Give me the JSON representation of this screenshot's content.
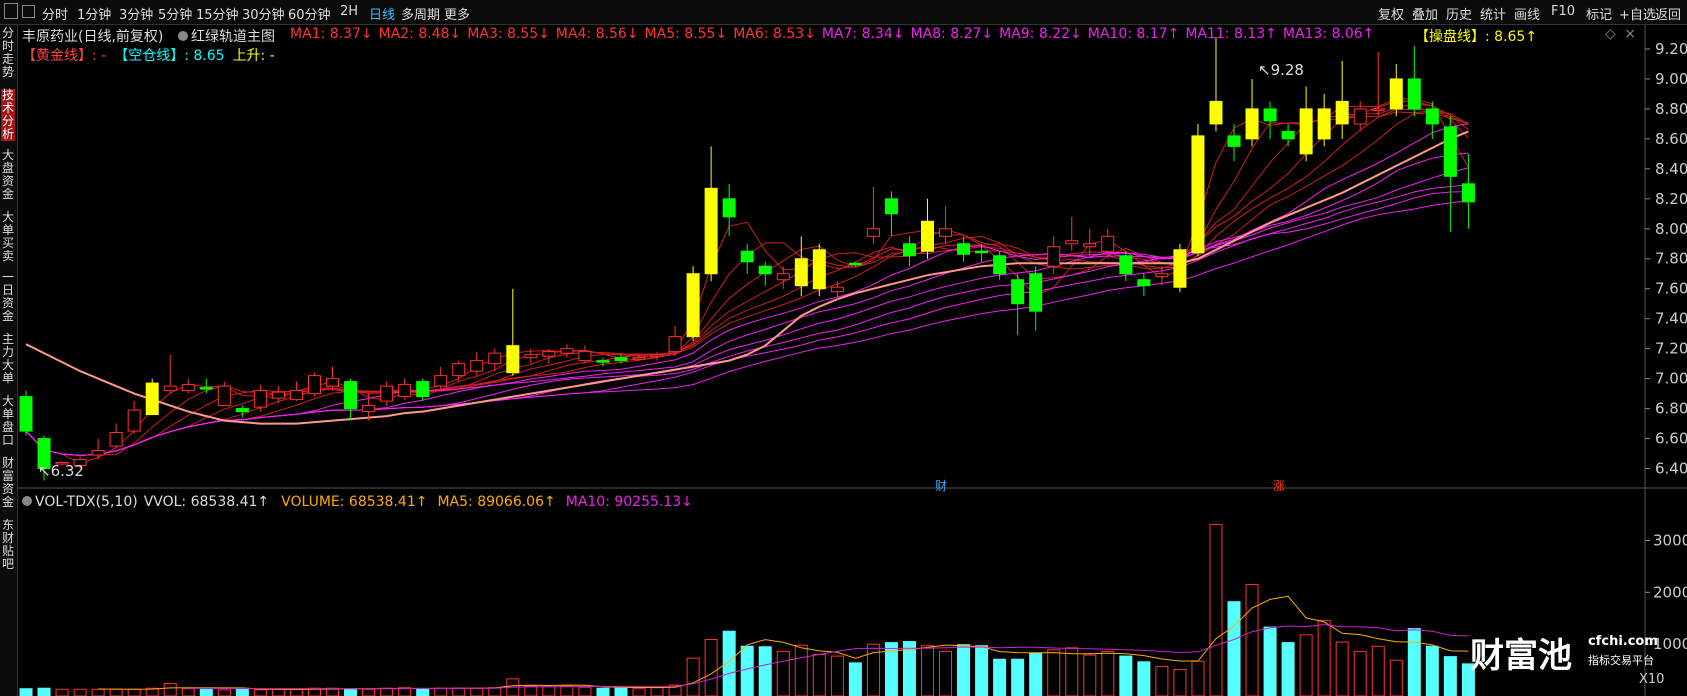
{
  "topbar": {
    "left_icons": [
      "grid-icon",
      "sidebar-icon"
    ],
    "periods": [
      "分时",
      "1分钟",
      "3分钟",
      "5分钟",
      "15分钟",
      "30分钟",
      "60分钟",
      "2H",
      "日线",
      "多周期",
      "更多"
    ],
    "active_period": "日线",
    "right": [
      "复权",
      "叠加",
      "历史",
      "统计",
      "画线",
      "F10",
      "标记",
      "+自选",
      "返回"
    ]
  },
  "leftnav": [
    "分时走势",
    "技术分析",
    "大盘资金",
    "大单买卖",
    "一日资金",
    "主力大单",
    "大单盘口",
    "财富资金",
    "东财贴吧"
  ],
  "leftnav_active": "技术分析",
  "header": {
    "stock": "丰原药业(日线,前复权)",
    "indicator": "红绿轨道主图",
    "ma": [
      {
        "label": "MA1: 8.37↓",
        "color": "#ff3333"
      },
      {
        "label": "MA2: 8.48↓",
        "color": "#ff3333"
      },
      {
        "label": "MA3: 8.55↓",
        "color": "#ff3333"
      },
      {
        "label": "MA4: 8.56↓",
        "color": "#ff3333"
      },
      {
        "label": "MA5: 8.55↓",
        "color": "#ff3333"
      },
      {
        "label": "MA6: 8.53↓",
        "color": "#ff3333"
      },
      {
        "label": "MA7: 8.34↓",
        "color": "#ee22ee"
      },
      {
        "label": "MA8: 8.27↓",
        "color": "#ee22ee"
      },
      {
        "label": "MA9: 8.22↓",
        "color": "#ee22ee"
      },
      {
        "label": "MA10: 8.17↑",
        "color": "#ee22ee"
      },
      {
        "label": "MA11: 8.13↑",
        "color": "#ee22ee"
      },
      {
        "label": "MA13: 8.06↑",
        "color": "#ee22ee"
      }
    ],
    "caopan": "【操盘线】: 8.65↑",
    "huangjin": "【黄金线】: -",
    "kongcang": "【空仓线】: 8.65",
    "shangsheng": "上升: -"
  },
  "volume_header": {
    "name": "VOL-TDX(5,10)",
    "vvol": "VVOL: 68538.41↑",
    "volume": "VOLUME: 68538.41↑",
    "ma5": "MA5: 89066.06↑",
    "ma10": "MA10: 90255.13↓"
  },
  "markers": {
    "cai": "财",
    "zhang": "涨",
    "high": "9.28",
    "low": "6.32"
  },
  "watermark": {
    "logo": "财富池",
    "domain": "cfchi.com",
    "slogan": "指标交易平台"
  },
  "colors": {
    "up": "#ff3232",
    "down": "#00ff00",
    "yellow": "#ffff00",
    "cyan": "#00ffff",
    "magenta": "#ee22ee",
    "salmon": "#ff9a8a",
    "vol_up": "#ff3232",
    "vol_down": "#5ff"
  },
  "chart_data": {
    "type": "candlestick",
    "title": "丰原药业(日线,前复权)",
    "price_axis": {
      "ticks": [
        6.4,
        6.6,
        6.8,
        7.0,
        7.2,
        7.4,
        7.6,
        7.8,
        8.0,
        8.2,
        8.4,
        8.6,
        8.8,
        9.0,
        9.2
      ],
      "range": [
        6.27,
        9.36
      ]
    },
    "volume_axis": {
      "ticks": [
        10000,
        20000,
        30000
      ],
      "range": [
        0,
        35500
      ],
      "unit": "X10"
    },
    "candles": [
      [
        6.88,
        6.65,
        6.92,
        6.62
      ],
      [
        6.6,
        6.4,
        6.62,
        6.32
      ],
      [
        6.43,
        6.44,
        6.45,
        6.42
      ],
      [
        6.42,
        6.46,
        6.48,
        6.4
      ],
      [
        6.49,
        6.52,
        6.6,
        6.46
      ],
      [
        6.55,
        6.64,
        6.7,
        6.54
      ],
      [
        6.65,
        6.79,
        6.85,
        6.63
      ],
      [
        6.76,
        6.97,
        7.0,
        6.76
      ],
      [
        6.92,
        6.95,
        7.16,
        6.9
      ],
      [
        6.92,
        6.96,
        7.0,
        6.9
      ],
      [
        6.94,
        6.93,
        7.0,
        6.9
      ],
      [
        6.82,
        6.95,
        6.98,
        6.82
      ],
      [
        6.8,
        6.78,
        6.82,
        6.74
      ],
      [
        6.81,
        6.92,
        6.96,
        6.78
      ],
      [
        6.87,
        6.91,
        6.95,
        6.84
      ],
      [
        6.86,
        6.92,
        6.98,
        6.85
      ],
      [
        6.9,
        7.02,
        7.04,
        6.88
      ],
      [
        6.95,
        7.0,
        7.08,
        6.92
      ],
      [
        6.98,
        6.8,
        7.0,
        6.72
      ],
      [
        6.78,
        6.82,
        6.9,
        6.72
      ],
      [
        6.85,
        6.95,
        6.98,
        6.82
      ],
      [
        6.88,
        6.96,
        7.0,
        6.86
      ],
      [
        6.98,
        6.88,
        7.0,
        6.85
      ],
      [
        6.95,
        7.02,
        7.08,
        6.92
      ],
      [
        7.02,
        7.1,
        7.12,
        6.98
      ],
      [
        7.05,
        7.12,
        7.18,
        7.02
      ],
      [
        7.1,
        7.17,
        7.2,
        7.05
      ],
      [
        7.04,
        7.22,
        7.6,
        7.02
      ],
      [
        7.14,
        7.16,
        7.2,
        7.1
      ],
      [
        7.15,
        7.18,
        7.2,
        7.1
      ],
      [
        7.17,
        7.2,
        7.23,
        7.14
      ],
      [
        7.12,
        7.18,
        7.22,
        7.1
      ],
      [
        7.12,
        7.11,
        7.14,
        7.08
      ],
      [
        7.14,
        7.12,
        7.16,
        7.1
      ],
      [
        7.14,
        7.14,
        7.16,
        7.12
      ],
      [
        7.15,
        7.16,
        7.18,
        7.12
      ],
      [
        7.18,
        7.28,
        7.35,
        7.15
      ],
      [
        7.28,
        7.7,
        7.75,
        7.25
      ],
      [
        7.7,
        8.27,
        8.55,
        7.65
      ],
      [
        8.2,
        8.08,
        8.3,
        7.95
      ],
      [
        7.85,
        7.78,
        7.9,
        7.7
      ],
      [
        7.75,
        7.7,
        7.78,
        7.62
      ],
      [
        7.66,
        7.7,
        7.75,
        7.6
      ],
      [
        7.62,
        7.8,
        7.95,
        7.55
      ],
      [
        7.6,
        7.86,
        7.9,
        7.55
      ],
      [
        7.58,
        7.61,
        7.65,
        7.52
      ],
      [
        7.77,
        7.76,
        7.78,
        7.75
      ],
      [
        7.95,
        8.0,
        8.28,
        7.9
      ],
      [
        8.2,
        8.1,
        8.25,
        7.95
      ],
      [
        7.9,
        7.82,
        7.95,
        7.75
      ],
      [
        7.85,
        8.05,
        8.2,
        7.8
      ],
      [
        7.95,
        8.0,
        8.15,
        7.9
      ],
      [
        7.9,
        7.83,
        7.95,
        7.78
      ],
      [
        7.85,
        7.84,
        7.9,
        7.78
      ],
      [
        7.82,
        7.7,
        7.85,
        7.66
      ],
      [
        7.66,
        7.5,
        7.7,
        7.29
      ],
      [
        7.7,
        7.45,
        7.75,
        7.32
      ],
      [
        7.75,
        7.88,
        7.95,
        7.7
      ],
      [
        7.9,
        7.92,
        8.08,
        7.85
      ],
      [
        7.88,
        7.9,
        8.0,
        7.82
      ],
      [
        7.85,
        7.95,
        8.0,
        7.8
      ],
      [
        7.82,
        7.7,
        7.85,
        7.65
      ],
      [
        7.66,
        7.62,
        7.7,
        7.55
      ],
      [
        7.68,
        7.7,
        7.75,
        7.62
      ],
      [
        7.61,
        7.86,
        7.9,
        7.58
      ],
      [
        7.84,
        8.62,
        8.7,
        7.82
      ],
      [
        8.7,
        8.85,
        9.28,
        8.65
      ],
      [
        8.62,
        8.55,
        8.7,
        8.45
      ],
      [
        8.6,
        8.8,
        9.0,
        8.55
      ],
      [
        8.8,
        8.72,
        8.85,
        8.6
      ],
      [
        8.65,
        8.6,
        8.7,
        8.55
      ],
      [
        8.5,
        8.8,
        8.95,
        8.45
      ],
      [
        8.6,
        8.8,
        8.9,
        8.55
      ],
      [
        8.7,
        8.85,
        9.12,
        8.6
      ],
      [
        8.7,
        8.8,
        8.85,
        8.65
      ],
      [
        8.8,
        8.8,
        9.18,
        8.75
      ],
      [
        8.8,
        9.0,
        9.1,
        8.75
      ],
      [
        9.0,
        8.8,
        9.22,
        8.75
      ],
      [
        8.8,
        8.7,
        8.85,
        8.6
      ],
      [
        8.68,
        8.35,
        8.75,
        7.98
      ],
      [
        8.3,
        8.18,
        8.5,
        8.0
      ]
    ],
    "volume": [
      1400,
      1500,
      1300,
      1300,
      1300,
      1300,
      1300,
      1500,
      2400,
      1400,
      1300,
      1200,
      1300,
      1200,
      1300,
      1300,
      1500,
      1500,
      1300,
      1300,
      1500,
      1600,
      1400,
      1500,
      1500,
      1500,
      1600,
      3300,
      1900,
      1800,
      1900,
      1700,
      1500,
      1500,
      1400,
      1600,
      2100,
      7300,
      10900,
      12500,
      9600,
      9500,
      8600,
      9800,
      8000,
      7700,
      6400,
      10000,
      10300,
      10500,
      9700,
      8600,
      9900,
      9700,
      7100,
      7100,
      8200,
      8900,
      9300,
      7900,
      8600,
      7700,
      6600,
      5700,
      5100,
      6700,
      33100,
      18200,
      21500,
      13300,
      10300,
      11800,
      14600,
      10400,
      8600,
      9600,
      6900,
      13000,
      9600,
      7600,
      6200
    ],
    "volume_ma5": [
      0,
      0,
      0,
      0,
      1360,
      1340,
      1300,
      1340,
      1560,
      1580,
      1580,
      1560,
      1560,
      1320,
      1300,
      1260,
      1320,
      1360,
      1380,
      1380,
      1420,
      1440,
      1460,
      1460,
      1500,
      1500,
      1540,
      1980,
      2060,
      2020,
      2100,
      2060,
      1800,
      1700,
      1640,
      1640,
      1700,
      2520,
      4280,
      6660,
      9880,
      10880,
      10360,
      9300,
      8700,
      8440,
      7260,
      8380,
      8680,
      8960,
      9380,
      9820,
      9700,
      9540,
      8560,
      8380,
      8340,
      8380,
      8160,
      8160,
      8240,
      8160,
      7800,
      7140,
      6760,
      6760,
      11100,
      13440,
      16980,
      18640,
      19240,
      15060,
      14300,
      12100,
      11840,
      11040,
      10460,
      10400,
      9860,
      8700,
      8660
    ],
    "volume_ma10": [
      0,
      0,
      0,
      0,
      0,
      0,
      0,
      0,
      0,
      1470,
      1460,
      1440,
      1440,
      1430,
      1420,
      1420,
      1420,
      1440,
      1400,
      1400,
      1420,
      1430,
      1440,
      1440,
      1460,
      1480,
      1490,
      1720,
      1760,
      1800,
      1820,
      1840,
      1850,
      1860,
      1870,
      1850,
      1880,
      2360,
      3260,
      4360,
      5200,
      6000,
      6700,
      7400,
      8000,
      8640,
      9140,
      9200,
      9160,
      9200,
      9200,
      9300,
      9460,
      9430,
      9300,
      9400,
      9400,
      9260,
      9160,
      9130,
      9020,
      8930,
      8800,
      8600,
      8400,
      8520,
      9800,
      10900,
      12400,
      13180,
      13500,
      13400,
      13780,
      13360,
      13340,
      13200,
      12560,
      12800,
      12500,
      11700,
      11600
    ],
    "caopan_line": [
      7.23,
      7.17,
      7.11,
      7.05,
      7.0,
      6.95,
      6.9,
      6.86,
      6.82,
      6.78,
      6.75,
      6.72,
      6.71,
      6.7,
      6.7,
      6.7,
      6.71,
      6.72,
      6.73,
      6.74,
      6.75,
      6.77,
      6.78,
      6.8,
      6.82,
      6.84,
      6.86,
      6.88,
      6.9,
      6.92,
      6.94,
      6.96,
      6.98,
      7.0,
      7.02,
      7.04,
      7.06,
      7.08,
      7.1,
      7.12,
      7.16,
      7.22,
      7.32,
      7.42,
      7.48,
      7.53,
      7.57,
      7.6,
      7.63,
      7.66,
      7.69,
      7.71,
      7.73,
      7.75,
      7.76,
      7.77,
      7.77,
      7.77,
      7.77,
      7.77,
      7.77,
      7.77,
      7.77,
      7.77,
      7.77,
      7.8,
      7.86,
      7.92,
      7.98,
      8.04,
      8.09,
      8.14,
      8.19,
      8.24,
      8.3,
      8.36,
      8.42,
      8.48,
      8.54,
      8.6,
      8.65
    ]
  }
}
